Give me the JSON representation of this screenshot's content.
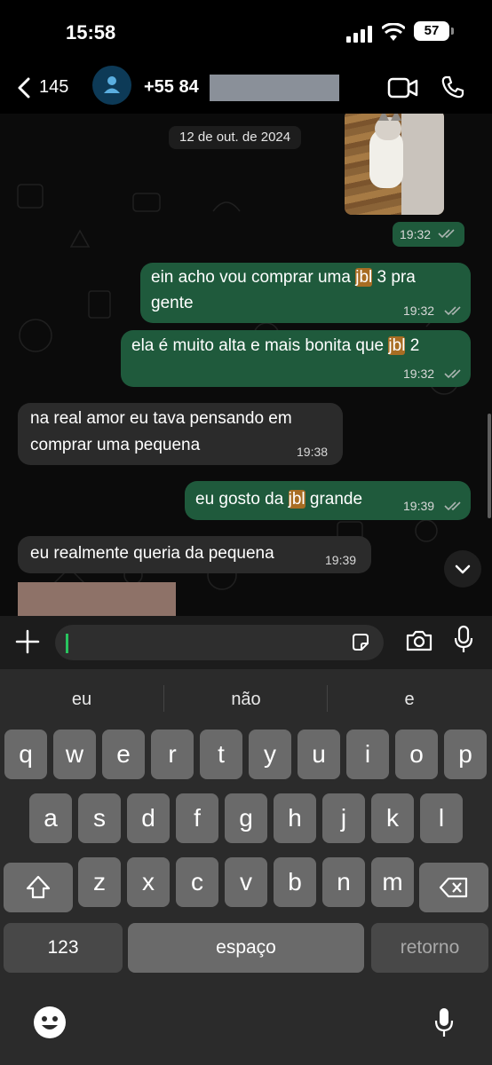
{
  "status": {
    "time": "15:58",
    "battery": "57"
  },
  "header": {
    "back_count": "145",
    "contact": "+55 84 "
  },
  "chat": {
    "date": "12 de out. de 2024",
    "image_time": "19:32",
    "messages": [
      {
        "dir": "out",
        "lines": [
          "ein acho vou comprar uma ",
          "jbl",
          " 3 pra",
          "gente"
        ],
        "time": "19:32",
        "read": true
      },
      {
        "dir": "out",
        "text_a": "ela é muito alta e mais bonita que ",
        "hl": "jbl",
        "text_b": " 2",
        "time": "19:32",
        "read": true
      },
      {
        "dir": "in",
        "line1": "na real amor eu tava pensando em",
        "line2": "comprar uma pequena",
        "time": "19:38"
      },
      {
        "dir": "out",
        "text_a": "eu gosto da ",
        "hl": "jbl",
        "text_b": " grande",
        "time": "19:39",
        "read": true
      },
      {
        "dir": "in",
        "text": "eu realmente queria da pequena",
        "time": "19:39"
      }
    ]
  },
  "keyboard": {
    "suggestions": [
      "eu",
      "não",
      "e"
    ],
    "row1": [
      "q",
      "w",
      "e",
      "r",
      "t",
      "y",
      "u",
      "i",
      "o",
      "p"
    ],
    "row2": [
      "a",
      "s",
      "d",
      "f",
      "g",
      "h",
      "j",
      "k",
      "l"
    ],
    "row3": [
      "z",
      "x",
      "c",
      "v",
      "b",
      "n",
      "m"
    ],
    "numbers": "123",
    "space": "espaço",
    "return": "retorno"
  },
  "icons": [
    "chevron-left-icon",
    "person-icon",
    "video-icon",
    "phone-icon",
    "plus-icon",
    "sticker-icon",
    "camera-icon",
    "mic-icon",
    "shift-icon",
    "backspace-icon",
    "emoji-icon",
    "chevron-down-icon"
  ],
  "colors": {
    "outgoing": "#1f5a3c",
    "incoming": "#2b2b2b",
    "highlight": "#a86d23",
    "caret": "#28c45f"
  }
}
